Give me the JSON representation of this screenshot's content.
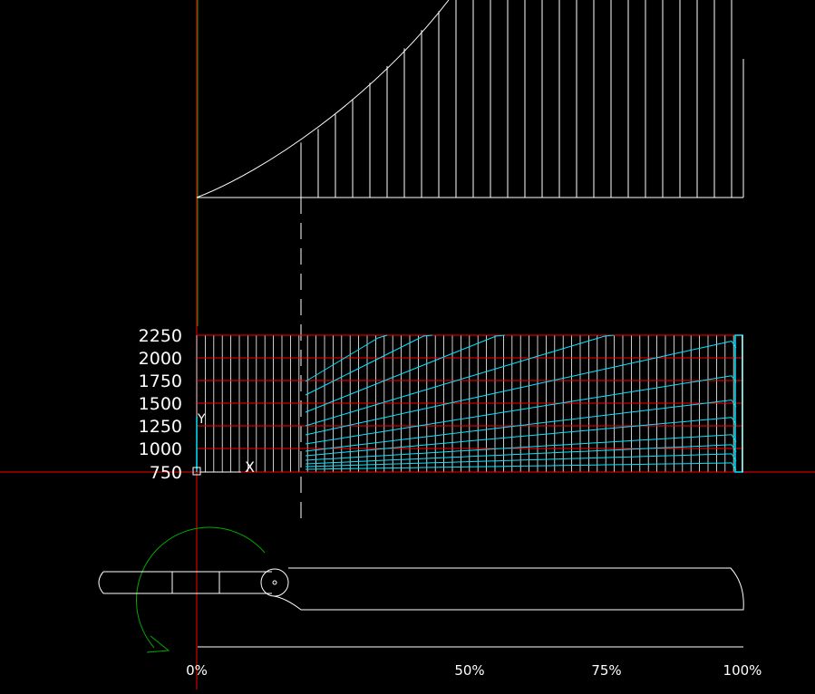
{
  "colors": {
    "background": "#000000",
    "line": "#ffffff",
    "grid": "#ff0000",
    "curve": "#00e5ff",
    "y_axis": "#00ff00",
    "rotation_arrow": "#00aa00"
  },
  "ucs_icon": {
    "y_label": "Y",
    "x_label": "X"
  },
  "y_axis": {
    "ticks": [
      "2250",
      "2000",
      "1750",
      "1500",
      "1250",
      "1000",
      "750"
    ]
  },
  "x_axis": {
    "ticks": [
      "0%",
      "50%",
      "75%",
      "100%"
    ]
  }
}
